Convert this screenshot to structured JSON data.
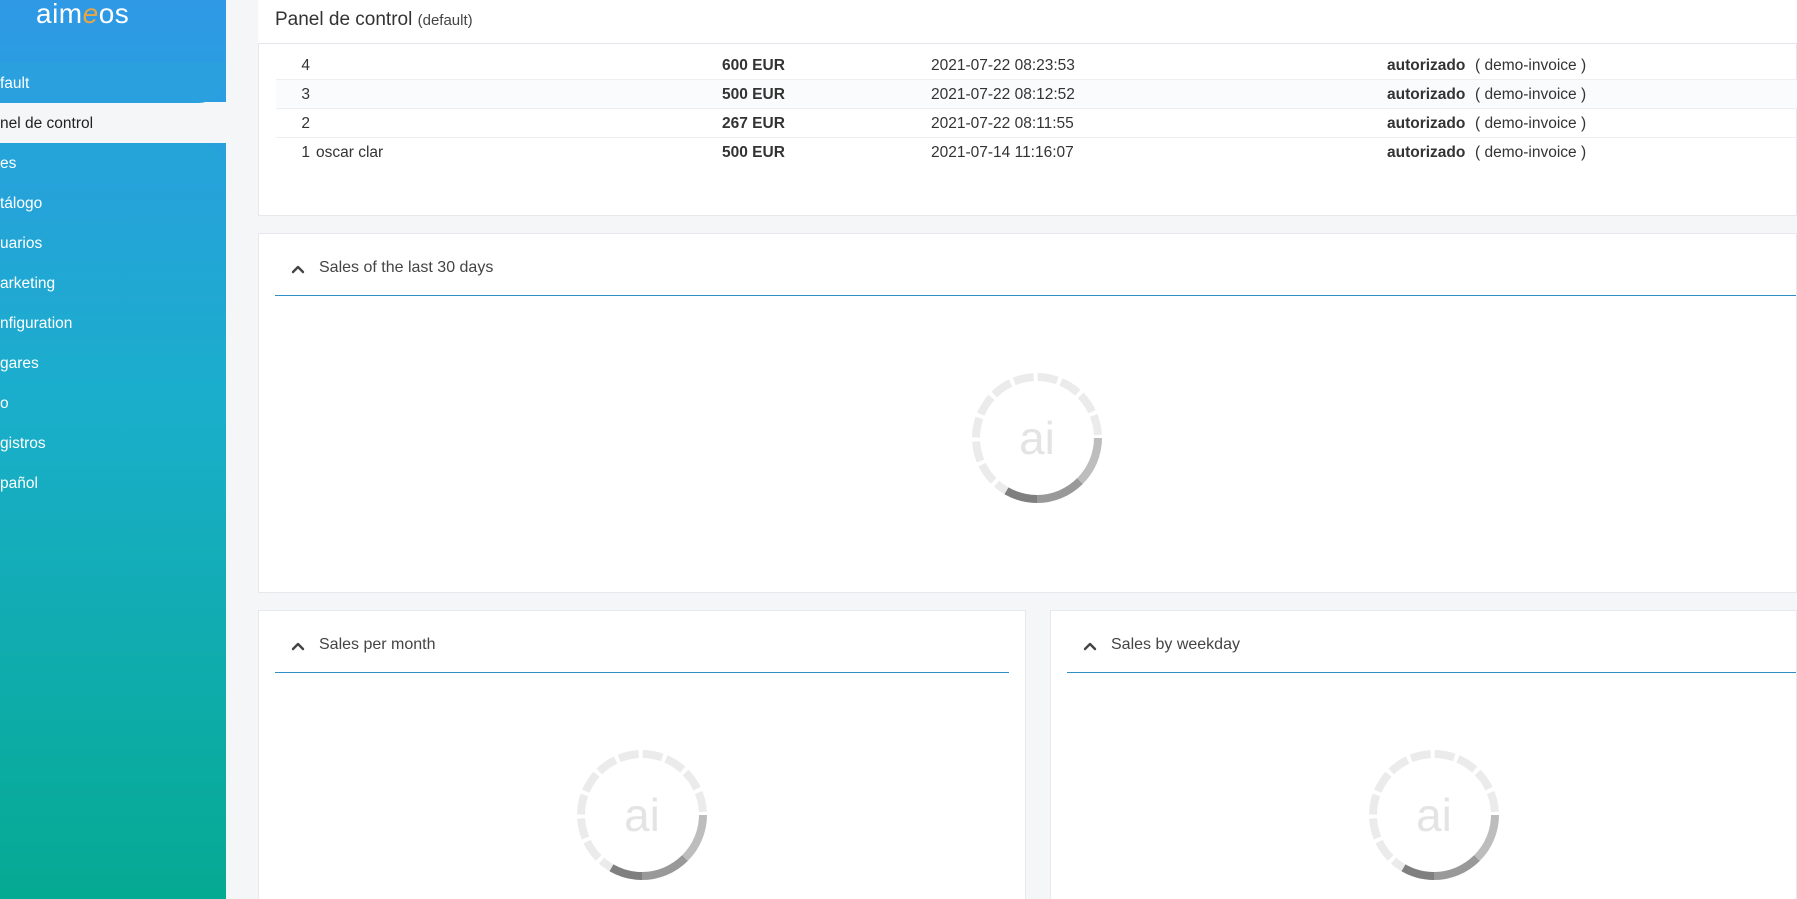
{
  "app": {
    "logo_prefix": "aim",
    "logo_accent": "e",
    "logo_suffix": "os"
  },
  "sidebar": {
    "items": [
      {
        "label": "fault"
      },
      {
        "label": "nel de control"
      },
      {
        "label": "es"
      },
      {
        "label": "tálogo"
      },
      {
        "label": "uarios"
      },
      {
        "label": "arketing"
      },
      {
        "label": "nfiguration"
      },
      {
        "label": "gares"
      },
      {
        "label": "o"
      },
      {
        "label": "gistros"
      },
      {
        "label": "pañol"
      }
    ]
  },
  "header": {
    "title": "Panel de control",
    "site": "(default)"
  },
  "orders": {
    "rows": [
      {
        "id": "4",
        "name": "",
        "price": "600 EUR",
        "date": "2021-07-22 08:23:53",
        "status": "autorizado",
        "service": "( demo-invoice )"
      },
      {
        "id": "3",
        "name": "",
        "price": "500 EUR",
        "date": "2021-07-22 08:12:52",
        "status": "autorizado",
        "service": "( demo-invoice )"
      },
      {
        "id": "2",
        "name": "",
        "price": "267 EUR",
        "date": "2021-07-22 08:11:55",
        "status": "autorizado",
        "service": "( demo-invoice )"
      },
      {
        "id": "1",
        "name": "oscar clar",
        "price": "500 EUR",
        "date": "2021-07-14 11:16:07",
        "status": "autorizado",
        "service": "( demo-invoice )"
      }
    ]
  },
  "cards": {
    "last30": {
      "title": "Sales of the last 30 days"
    },
    "per_month": {
      "title": "Sales per month"
    },
    "by_weekday": {
      "title": "Sales by weekday"
    }
  },
  "spinner_label": "ai",
  "colors": {
    "accent": "#2f8fc6",
    "logo_accent": "#e8a642",
    "sidebar_top": "#2f99e6",
    "sidebar_bottom": "#05aa92"
  }
}
